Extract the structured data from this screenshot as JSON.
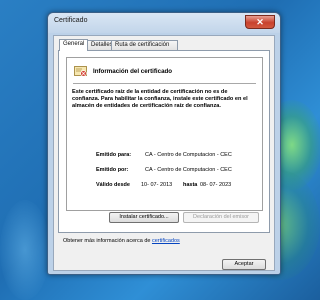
{
  "window": {
    "title": "Certificado",
    "close_glyph": "✕"
  },
  "tabs": [
    {
      "label": "General",
      "active": true
    },
    {
      "label": "Detalles",
      "active": false
    },
    {
      "label": "Ruta de certificación",
      "active": false
    }
  ],
  "info": {
    "heading": "Información del certificado",
    "purpose": "Este certificado raíz de la entidad de certificación no es de confianza. Para habilitar la confianza, instale este certificado en el almacén de entidades de certificación raíz de confianza.",
    "issued_to_label": "Emitido para:",
    "issued_to_value": "CA - Centro de Computacion - CEC",
    "issued_by_label": "Emitido por:",
    "issued_by_value": "CA - Centro de Computacion - CEC",
    "valid_from_label": "Válido desde",
    "valid_from_value": "10- 07- 2013",
    "valid_to_label": "hasta",
    "valid_to_value": "08- 07- 2023"
  },
  "buttons": {
    "install": "Instalar certificado...",
    "issuer_statement": "Declaración del emisor",
    "ok": "Aceptar"
  },
  "learn_more": {
    "prefix": "Obtener más información acerca de",
    "link": "certificados"
  },
  "colors": {
    "warning_accent": "#d33a2c",
    "link": "#0645c0"
  }
}
